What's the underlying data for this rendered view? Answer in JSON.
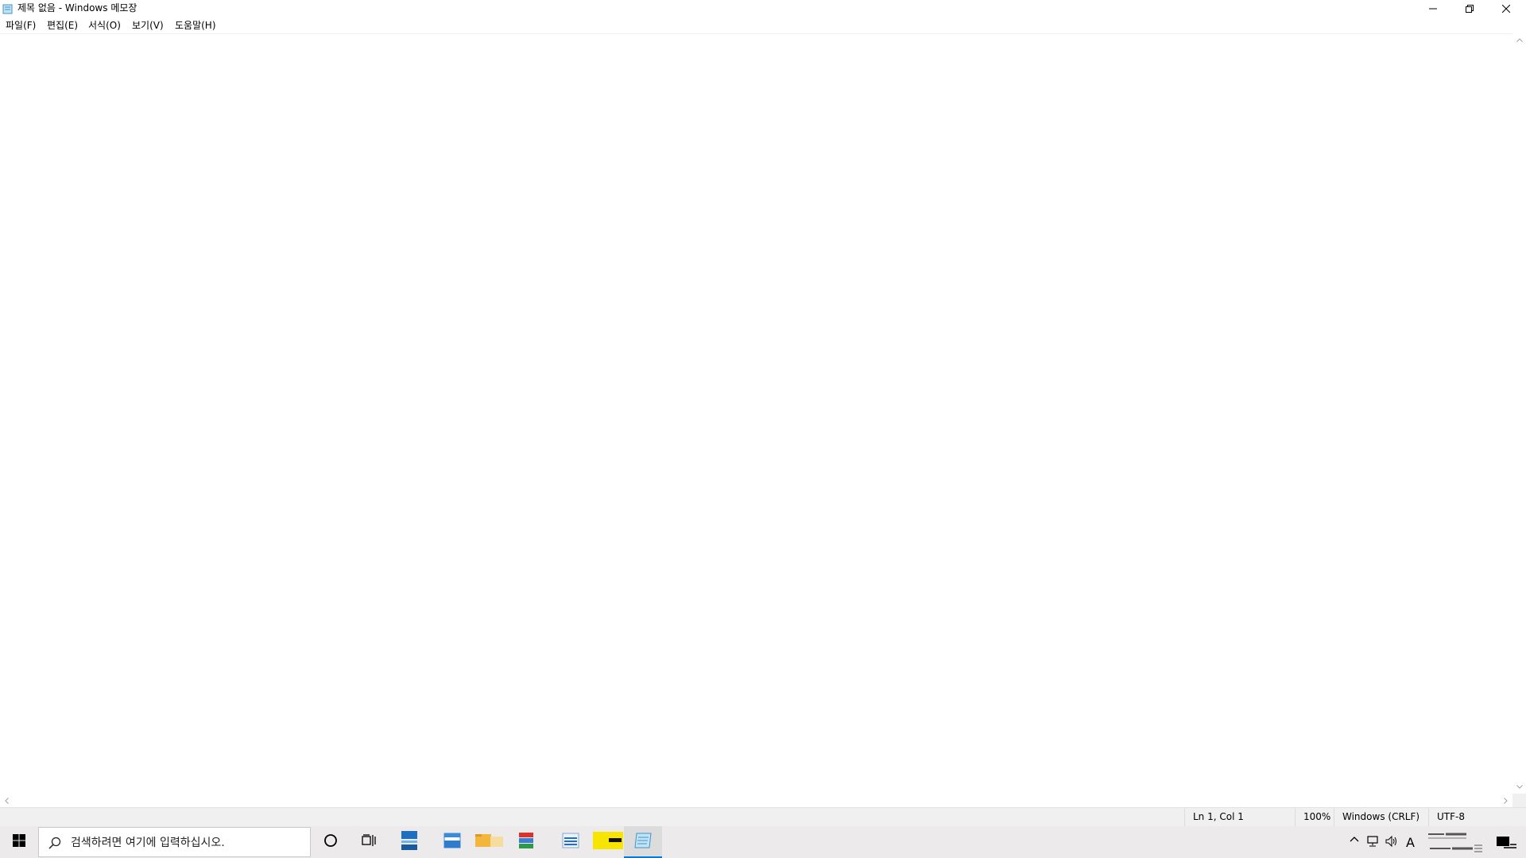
{
  "window": {
    "title": "제목 없음 - Windows 메모장",
    "minimize_icon": "minimize-icon",
    "maximize_icon": "restore-icon",
    "close_icon": "close-icon"
  },
  "menu": {
    "items": [
      {
        "label": "파일(F)"
      },
      {
        "label": "편집(E)"
      },
      {
        "label": "서식(O)"
      },
      {
        "label": "보기(V)"
      },
      {
        "label": "도움말(H)"
      }
    ]
  },
  "editor": {
    "content": ""
  },
  "status": {
    "position": "Ln 1, Col 1",
    "zoom": "100%",
    "line_ending": "Windows (CRLF)",
    "encoding": "UTF-8"
  },
  "taskbar": {
    "search_placeholder": "검색하려면 여기에 입력하십시오.",
    "apps": [
      {
        "icon": "start-icon"
      },
      {
        "icon": "cortana-icon"
      },
      {
        "icon": "task-view-icon"
      },
      {
        "icon": "app-icon-1"
      },
      {
        "icon": "app-icon-2"
      },
      {
        "icon": "file-explorer-icon"
      },
      {
        "icon": "app-icon-3"
      },
      {
        "icon": "app-icon-4"
      },
      {
        "icon": "app-icon-5"
      },
      {
        "icon": "notepad-icon"
      }
    ],
    "tray": {
      "ime_label": "A"
    }
  },
  "colors": {
    "accent": "#0078d7",
    "taskbar_bg": "#eceaea",
    "status_bg": "#f0f0f0"
  }
}
